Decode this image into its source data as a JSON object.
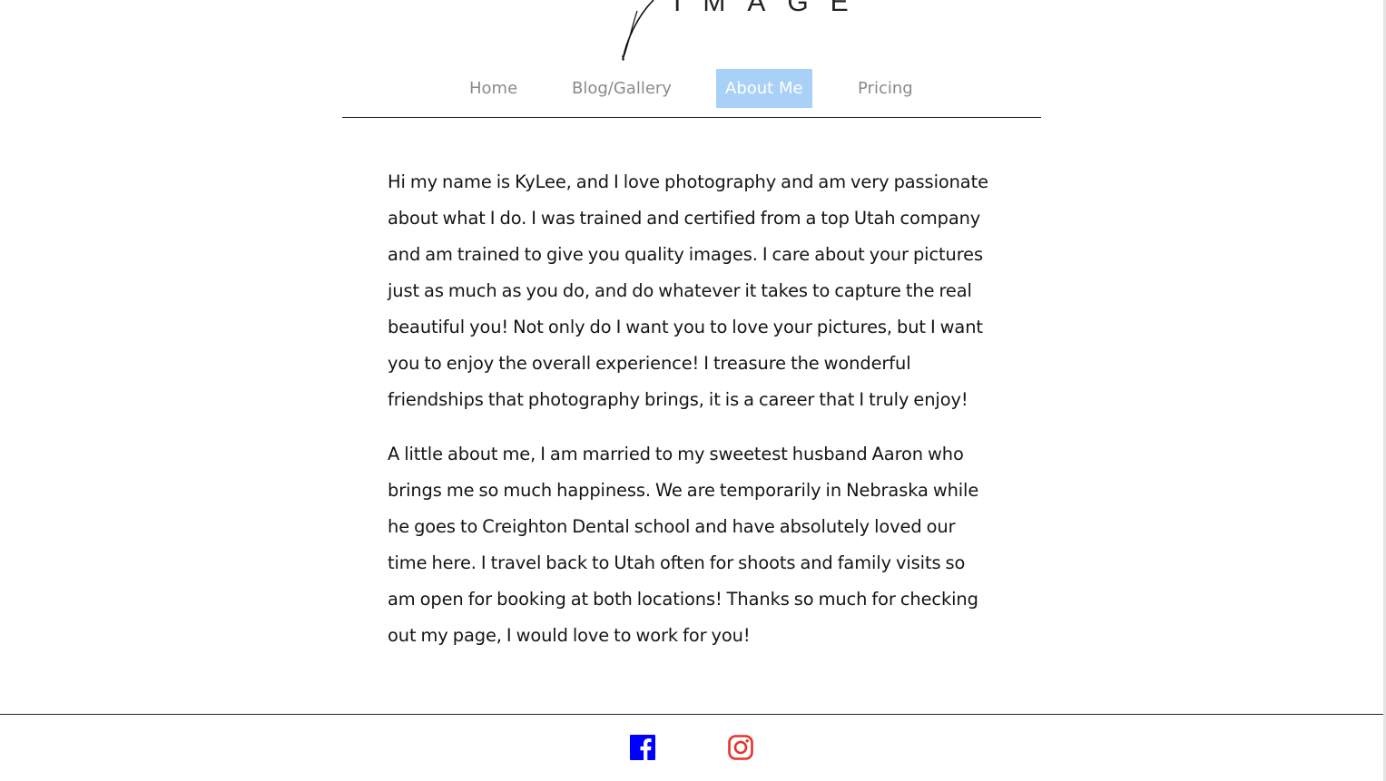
{
  "logo": {
    "text": "IMAGE"
  },
  "nav": {
    "items": [
      {
        "label": "Home",
        "active": false
      },
      {
        "label": "Blog/Gallery",
        "active": false
      },
      {
        "label": "About Me",
        "active": true
      },
      {
        "label": "Pricing",
        "active": false
      }
    ]
  },
  "about": {
    "paragraphs": [
      "Hi my name is KyLee, and I love photography and am very passionate about what I do. I was trained and certified from a top Utah company and am trained to give you quality images. I care about your pictures just as much as you do, and do whatever it takes to capture the real beautiful you! Not only do I want you to love your pictures, but I want you to enjoy the overall experience! I treasure the wonderful friendships that photography brings, it is a career that I truly enjoy!",
      "A little about me, I am married to my sweetest husband Aaron who brings me so much happiness. We are temporarily in Nebraska while he goes to Creighton Dental school and have absolutely loved our time here. I travel back to Utah often for shoots and family visits so am open for booking at both locations! Thanks so much for checking out my page, I would love to work for you!"
    ]
  },
  "footer": {
    "social": [
      {
        "icon": "facebook-icon",
        "color": "#0000ff"
      },
      {
        "icon": "instagram-icon",
        "color": "#e8322a"
      }
    ]
  },
  "colors": {
    "nav_active_bg": "#a9d1f7",
    "nav_text": "#8a8a8a",
    "body_text": "#151515"
  }
}
